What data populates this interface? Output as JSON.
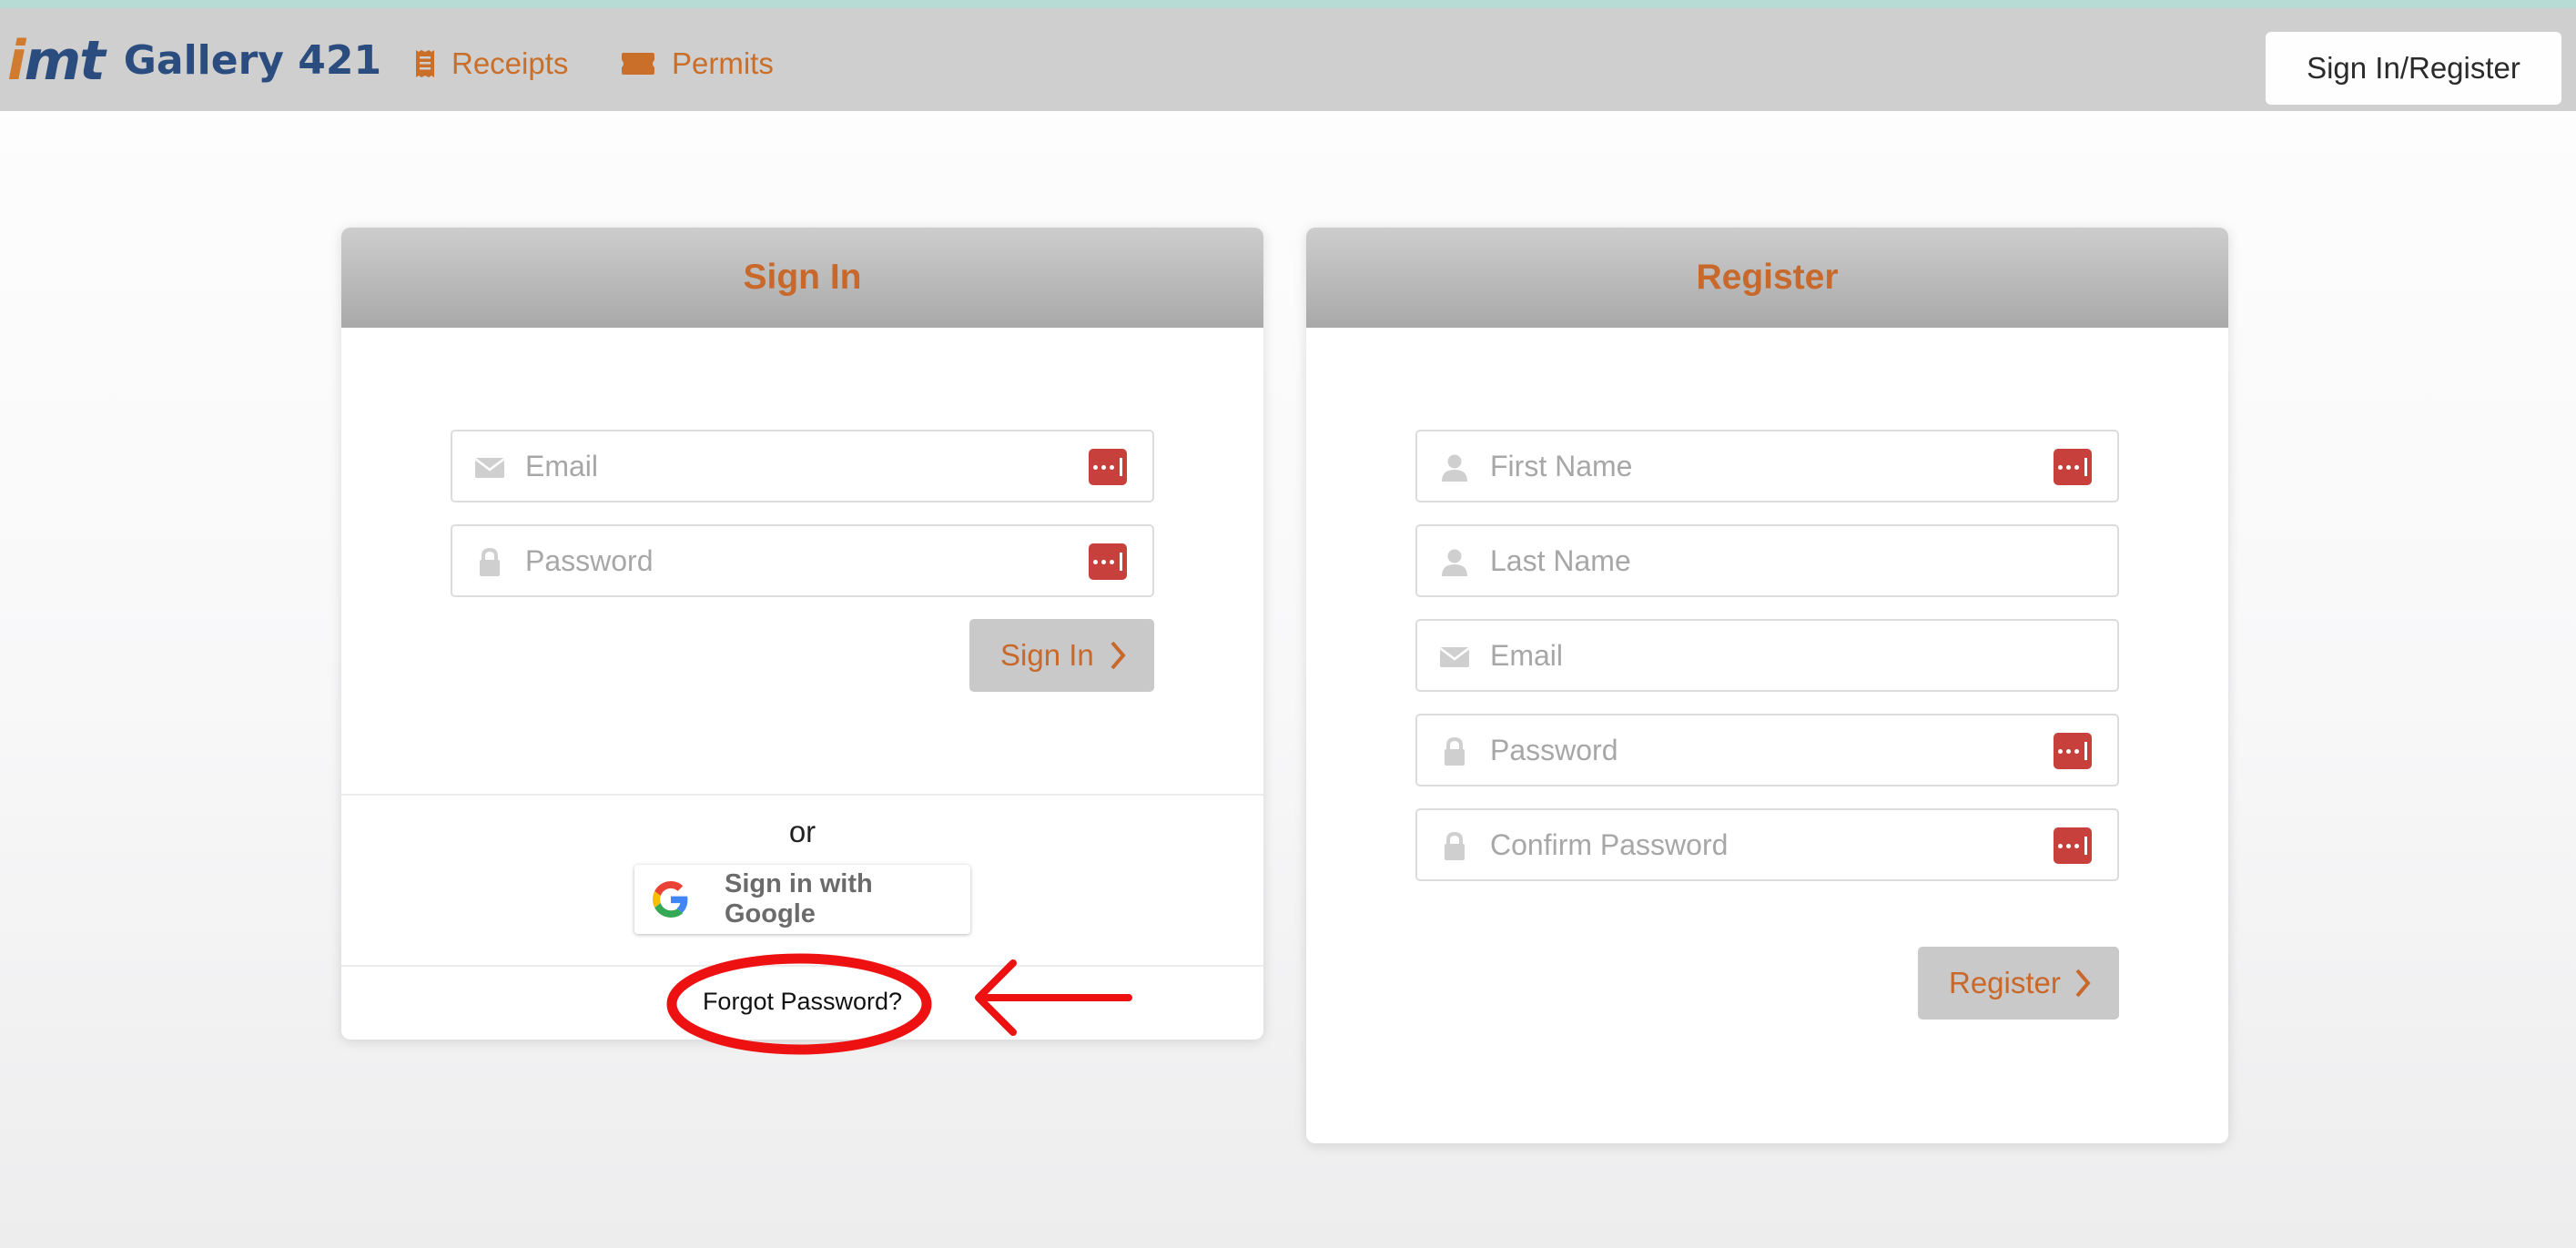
{
  "navbar": {
    "logo_mark": "imt",
    "logo_name": "Gallery 421",
    "links": [
      {
        "label": "Receipts",
        "icon": "receipt-icon"
      },
      {
        "label": "Permits",
        "icon": "ticket-icon"
      }
    ],
    "signin_register_label": "Sign In/Register"
  },
  "signin": {
    "title": "Sign In",
    "email_placeholder": "Email",
    "password_placeholder": "Password",
    "submit_label": "Sign In",
    "or_label": "or",
    "google_label": "Sign in with Google",
    "forgot_label": "Forgot Password?"
  },
  "register": {
    "title": "Register",
    "first_name_placeholder": "First Name",
    "last_name_placeholder": "Last Name",
    "email_placeholder": "Email",
    "password_placeholder": "Password",
    "confirm_password_placeholder": "Confirm Password",
    "submit_label": "Register"
  },
  "colors": {
    "accent": "#c8682a",
    "brand_blue": "#2b4c7e",
    "password_manager": "#c7403c",
    "annotation_red": "#ee1111"
  }
}
